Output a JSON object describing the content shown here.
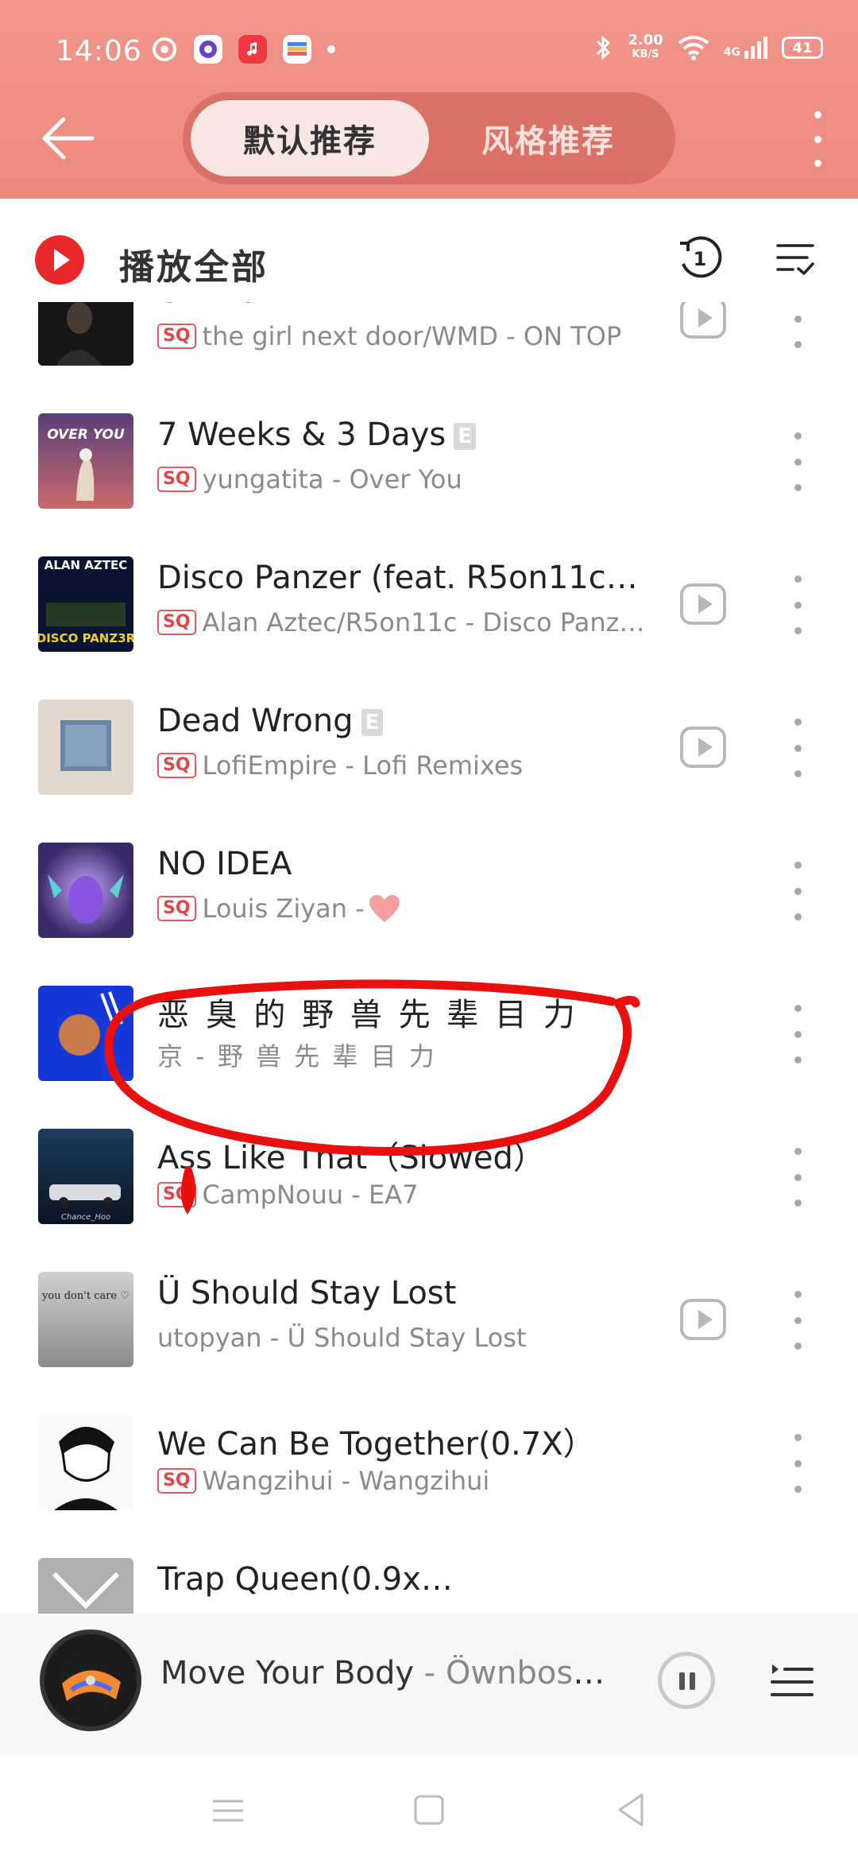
{
  "status_bar": {
    "time": "14:06",
    "net_speed_value": "2.00",
    "net_speed_unit": "KB/S",
    "network": "4G",
    "battery": "41"
  },
  "header": {
    "tabs": [
      {
        "label": "默认推荐",
        "active": true
      },
      {
        "label": "风格推荐",
        "active": false
      }
    ]
  },
  "play_all": {
    "label": "播放全部",
    "repeat_badge": "1"
  },
  "songs": [
    {
      "title": "ON TOP",
      "sq": true,
      "explicit": false,
      "subtitle": "the girl next door/WMD - ON TOP",
      "has_mv": true
    },
    {
      "title": "7 Weeks & 3 Days",
      "sq": true,
      "explicit": true,
      "subtitle": "yungatita - Over You",
      "has_mv": false
    },
    {
      "title": "Disco Panzer (feat. R5on11c)…",
      "sq": true,
      "explicit": false,
      "subtitle": "Alan Aztec/R5on11c - Disco Panz…",
      "has_mv": true
    },
    {
      "title": "Dead Wrong",
      "sq": true,
      "explicit": true,
      "subtitle": "LofiEmpire - Lofi Remixes",
      "has_mv": true
    },
    {
      "title": "NO IDEA",
      "sq": true,
      "explicit": false,
      "subtitle": "Louis Ziyan - ",
      "heart": true,
      "has_mv": false
    },
    {
      "title": "恶 臭 的 野 兽 先 辈 目 力",
      "sq": false,
      "explicit": false,
      "subtitle": "京 - 野 兽 先 辈 目 力",
      "has_mv": false
    },
    {
      "title": "Ass Like That（Slowed）",
      "sq": true,
      "explicit": false,
      "subtitle": "CampNouu - EA7",
      "has_mv": false
    },
    {
      "title": "Ü Should Stay Lost",
      "sq": false,
      "explicit": false,
      "subtitle": "utopyan - Ü Should Stay Lost",
      "has_mv": true
    },
    {
      "title": "We Can Be Together(0.7X）",
      "sq": true,
      "explicit": false,
      "subtitle": "Wangzihui - Wangzihui",
      "has_mv": false
    },
    {
      "title": "Trap Queen(0.9x…",
      "sq": true,
      "explicit": false,
      "subtitle": "",
      "has_mv": false
    }
  ],
  "labels": {
    "sq": "SQ",
    "explicit": "E"
  },
  "cover_texts": {
    "over_you": "OVER YOU",
    "alan_aztec": "ALAN AZTEC",
    "disco_panzer": "DISCO PANZ3R",
    "dont_care": "you don't care ♡",
    "chance": "Chance_Hoo"
  },
  "player": {
    "title": "Move Your Body",
    "separator": " - ",
    "artist": "Öwnboss…"
  },
  "colors": {
    "header": "#ee8a7f",
    "accent_red": "#e8282a",
    "annotation": "#e8110f"
  }
}
